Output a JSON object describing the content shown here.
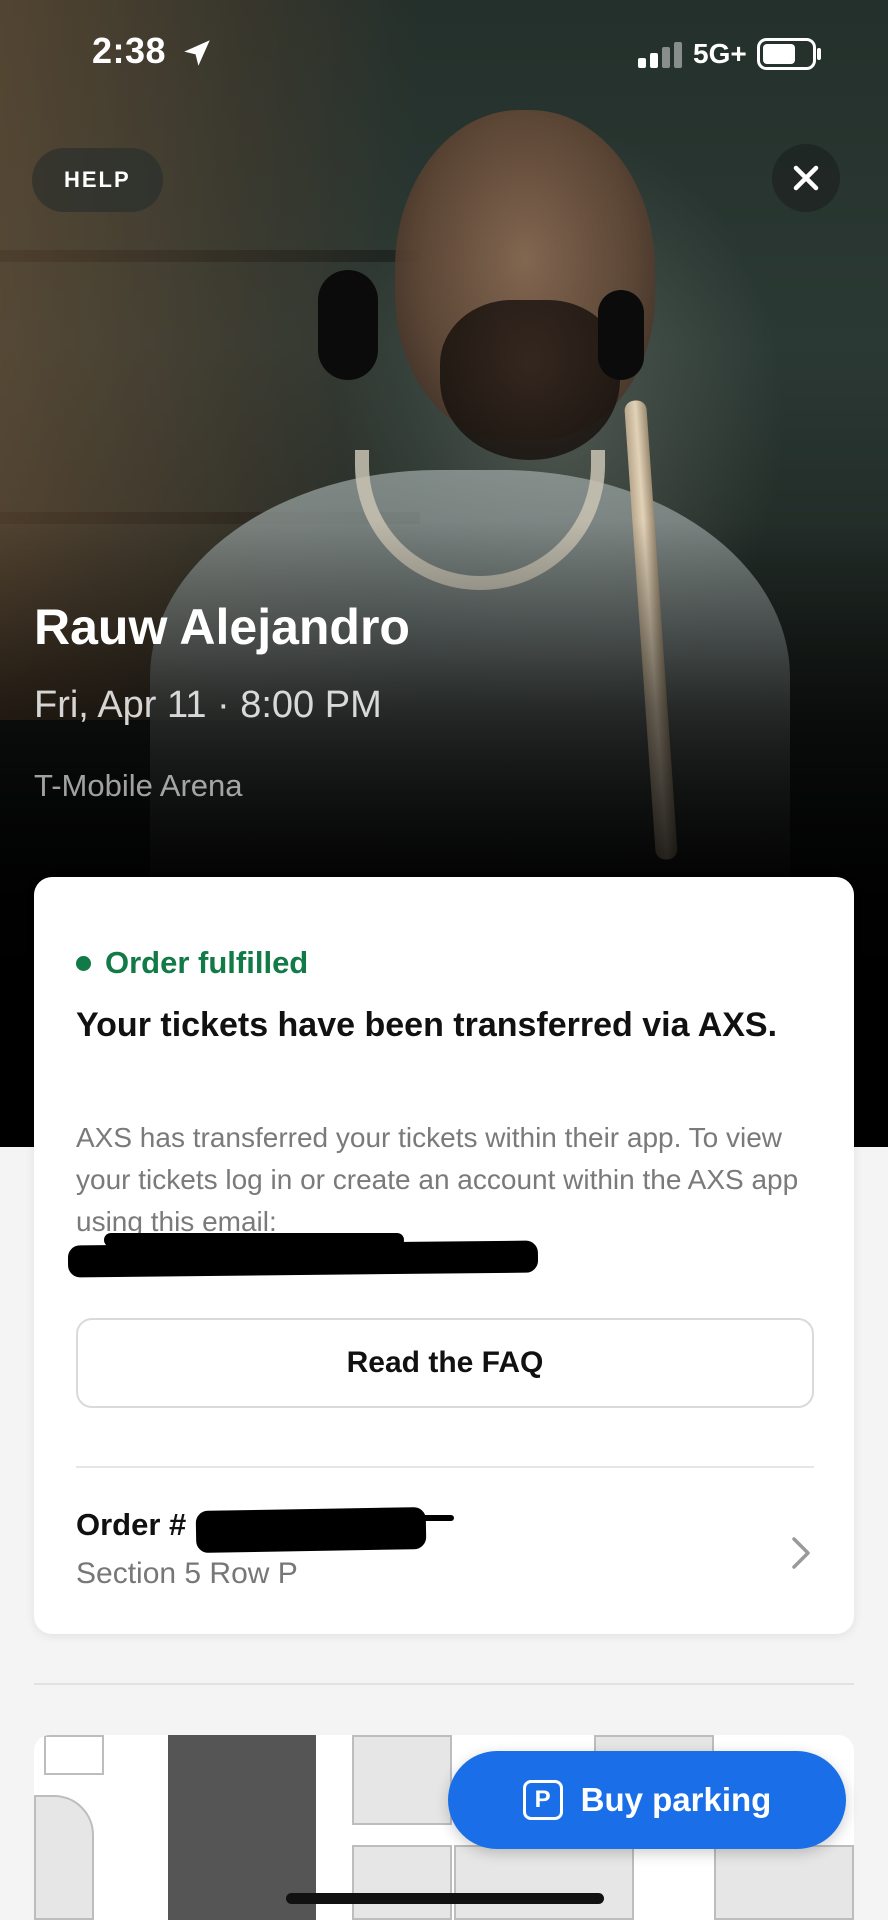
{
  "status_bar": {
    "time": "2:38",
    "network": "5G+"
  },
  "header": {
    "help_label": "HELP"
  },
  "event": {
    "title": "Rauw Alejandro",
    "datetime": "Fri, Apr 11 · 8:00 PM",
    "venue": "T-Mobile Arena"
  },
  "card": {
    "status": "Order fulfilled",
    "status_color": "#117a47",
    "heading": "Your tickets have been transferred via AXS.",
    "body": "AXS has transferred your tickets within their app. To view your tickets log in or create an account within the AXS app using this email:",
    "faq_label": "Read the FAQ",
    "order_label": "Order #",
    "order_section": "Section 5 Row P"
  },
  "parking": {
    "icon_letter": "P",
    "label": "Buy parking",
    "color": "#1a6fe8"
  }
}
